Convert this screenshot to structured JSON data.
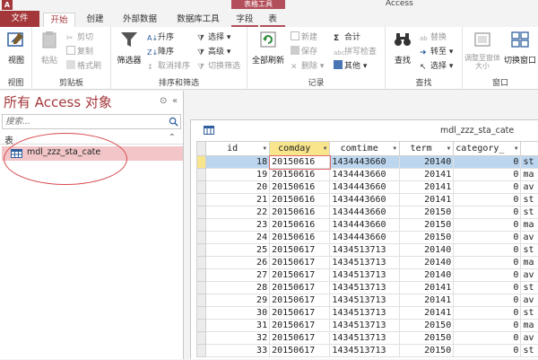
{
  "app": {
    "icon_letter": "A",
    "title": "Access",
    "context_tab": "表格工具"
  },
  "tabs": [
    {
      "label": "文件"
    },
    {
      "label": "开始"
    },
    {
      "label": "创建"
    },
    {
      "label": "外部数据"
    },
    {
      "label": "数据库工具"
    },
    {
      "label": "字段"
    },
    {
      "label": "表"
    }
  ],
  "ribbon": {
    "view": {
      "btn": "视图",
      "group": "视图"
    },
    "clipboard": {
      "paste": "粘贴",
      "cut": "剪切",
      "copy": "复制",
      "format_painter": "格式刷",
      "group": "剪贴板"
    },
    "sort": {
      "filter": "筛选器",
      "asc": "升序",
      "desc": "降序",
      "remove_sort": "取消排序",
      "selection": "选择",
      "advanced": "高级",
      "toggle_filter": "切换筛选",
      "group": "排序和筛选"
    },
    "records": {
      "refresh": "全部刷新",
      "new": "新建",
      "save": "保存",
      "delete": "删除",
      "totals": "合计",
      "spelling": "拼写检查",
      "more": "其他",
      "group": "记录"
    },
    "find": {
      "find": "查找",
      "replace": "替换",
      "goto": "转至",
      "select": "选择",
      "group": "查找"
    },
    "window": {
      "fit": "调整至窗体大小",
      "switch": "切换窗口",
      "group": "窗口"
    }
  },
  "nav": {
    "title": "所有 Access 对象",
    "search_placeholder": "搜索...",
    "section": "表",
    "item": "mdl_zzz_sta_cate"
  },
  "doc": {
    "title": "mdl_zzz_sta_cate"
  },
  "table": {
    "columns": [
      "id",
      "comday",
      "comtime",
      "term",
      "category_"
    ],
    "rows": [
      [
        "18",
        "20150616",
        "1434443660",
        "20140",
        "0",
        "st"
      ],
      [
        "19",
        "20150616",
        "1434443660",
        "20141",
        "0",
        "ma"
      ],
      [
        "20",
        "20150616",
        "1434443660",
        "20141",
        "0",
        "av"
      ],
      [
        "21",
        "20150616",
        "1434443660",
        "20141",
        "0",
        "st"
      ],
      [
        "22",
        "20150616",
        "1434443660",
        "20150",
        "0",
        "st"
      ],
      [
        "23",
        "20150616",
        "1434443660",
        "20150",
        "0",
        "ma"
      ],
      [
        "24",
        "20150616",
        "1434443660",
        "20150",
        "0",
        "av"
      ],
      [
        "25",
        "20150617",
        "1434513713",
        "20140",
        "0",
        "st"
      ],
      [
        "26",
        "20150617",
        "1434513713",
        "20140",
        "0",
        "ma"
      ],
      [
        "27",
        "20150617",
        "1434513713",
        "20140",
        "0",
        "av"
      ],
      [
        "28",
        "20150617",
        "1434513713",
        "20141",
        "0",
        "st"
      ],
      [
        "29",
        "20150617",
        "1434513713",
        "20141",
        "0",
        "av"
      ],
      [
        "30",
        "20150617",
        "1434513713",
        "20141",
        "0",
        "st"
      ],
      [
        "31",
        "20150617",
        "1434513713",
        "20150",
        "0",
        "ma"
      ],
      [
        "32",
        "20150617",
        "1434513713",
        "20150",
        "0",
        "av"
      ],
      [
        "33",
        "20150617",
        "1434513713",
        "20150",
        "0",
        "st"
      ]
    ]
  }
}
